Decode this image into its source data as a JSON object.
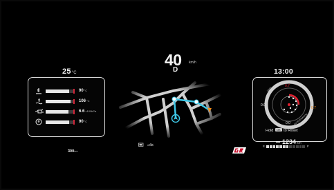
{
  "left": {
    "outside_temp": "25",
    "outside_temp_unit": "°C",
    "gauges": [
      {
        "icon": "engine-oil-temp-icon",
        "level": 0.82,
        "value": "90",
        "unit": "°C"
      },
      {
        "icon": "coolant-temp-icon",
        "level": 0.86,
        "value": "106",
        "unit": "°C"
      },
      {
        "icon": "oil-pressure-icon",
        "level": 0.78,
        "value": "6.6",
        "unit": "×100kPa"
      },
      {
        "icon": "transmission-temp-icon",
        "level": 0.8,
        "value": "90",
        "unit": "°C"
      }
    ],
    "range_value": "300",
    "range_unit": "km"
  },
  "center": {
    "speed": "40",
    "speed_unit": "km/h",
    "gear": "D",
    "status_icons": [
      "battery-icon",
      "no-signal-icon"
    ],
    "brand_logo": "gr-logo",
    "route_color": "#3fc9e8",
    "destination_color": "#f08c1c"
  },
  "right": {
    "clock": "13:00",
    "gforce": {
      "top_label": "0.7",
      "left_label": "0.0",
      "right_label": "0.7",
      "bottom_label": "0.0",
      "ring_labels": [
        "LEFT",
        "RIGHT",
        "BRAKE",
        "ACCELERATION"
      ]
    },
    "hold_text_before": "Hold",
    "hold_button": "OK",
    "hold_text_after": "to Reset",
    "odometer": "1234",
    "odometer_unit": "km",
    "fuel_empty_label": "E",
    "fuel_full_label": "F",
    "fuel_level": 0.55,
    "accent_red": "#e02030",
    "accent_orange": "#f08c1c"
  }
}
